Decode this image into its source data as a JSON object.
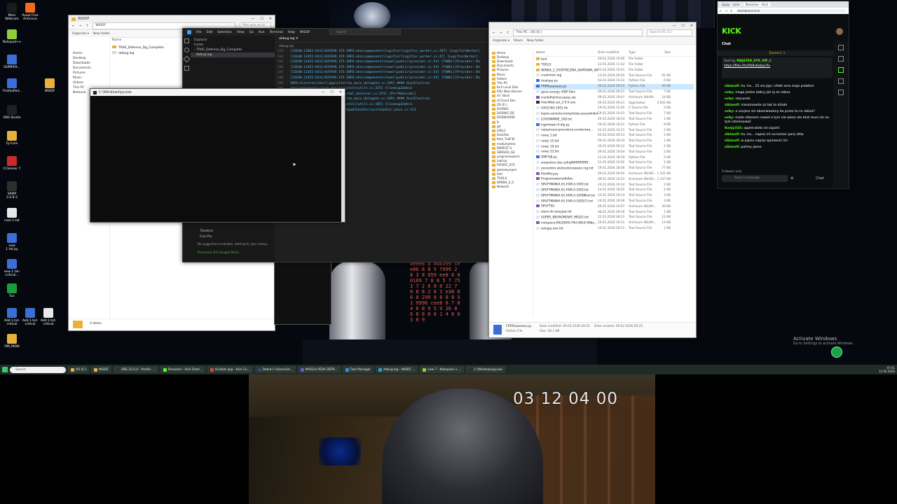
{
  "desktop": {
    "icons": [
      {
        "label": "Mein Webcam",
        "color": "#1b1b1b"
      },
      {
        "label": "Avast Free Antivirus",
        "color": "#f06b1e"
      },
      {
        "label": "Notepad++",
        "color": "#8fcf3c"
      },
      {
        "label": "DUMPER...",
        "color": "#3a6fd8"
      },
      {
        "label": "FirefoxPort...",
        "color": "#3a6fd8"
      },
      {
        "label": "OBS Studio",
        "color": "#202020"
      },
      {
        "label": "Fy-Cam",
        "color": "#e8b23a"
      },
      {
        "label": "CCleaner 7",
        "color": "#cc2b2b"
      },
      {
        "label": "SRMP 3.0.8-2",
        "color": "#2e2e2e"
      },
      {
        "label": "nazr-1.txt",
        "color": "#e8e8e8"
      },
      {
        "label": "new 1.txt.py",
        "color": "#3a6fd8"
      },
      {
        "label": "new 1.txt-critical...",
        "color": "#3a6fd8"
      },
      {
        "label": "Tux",
        "color": "#1a9e3a"
      },
      {
        "label": "Add 1.txt-critical",
        "color": "#3a6fd8"
      },
      {
        "label": "Add 1.txt-critical",
        "color": "#3a6fd8"
      },
      {
        "label": "Add 1.txt-critical",
        "color": "#e8e8e8"
      },
      {
        "label": "OM_MAIN",
        "color": "#e8b23a"
      },
      {
        "label": "WSIDF",
        "color": "#e8b23a"
      }
    ],
    "activate_title": "Activate Windows",
    "activate_sub": "Go to Settings to activate Windows."
  },
  "explorer_left": {
    "address": "WSIDF",
    "search": "Ples wsa.eu.tu",
    "toolbar": [
      "Organize ▾",
      "New folder"
    ],
    "side": [
      "Home",
      "Desktop",
      "Downloads",
      "Documents",
      "Pictures",
      "Music",
      "Videos",
      "This PC",
      "Network"
    ],
    "header": "Name",
    "files": [
      "TRAE_Defense_Dg_Complete",
      "debug.log"
    ],
    "status": "2 items"
  },
  "vscode": {
    "menu": [
      "File",
      "Edit",
      "Selection",
      "View",
      "Go",
      "Run",
      "Terminal",
      "Help",
      "WSIDF"
    ],
    "search": "Search",
    "explorer_title": "Explorer",
    "folder_label": "Folder",
    "tree": [
      "TRAE_Defense_Dg_Complete",
      "debug.log"
    ],
    "tab": "debug.log",
    "breadcrumb": "debug.log",
    "lines": [
      {
        "n": "533",
        "text": "[12648:13052:0311/035939.155:INFO:aho\\components\\logifier\\logifier_worker.cc:297] [LogifierWorker]"
      },
      {
        "n": "534",
        "text": "[12648:12452:0311/035939.155:INFO:aho\\components\\logifier\\logifier_worker.cc:47] [LogifierWorker]"
      },
      {
        "n": "535",
        "text": "[12648:12452:0311/035939.155:INFO:aho\\components\\towel\\public\\provider.cc:54] [TOWEL][Provider::Do"
      },
      {
        "n": "536",
        "text": "[12648:12452:0311/035939.155:INFO:aho\\components\\towel\\public\\provider.cc:54] [TOWEL][Provider::Do"
      },
      {
        "n": "537",
        "text": "[12648:12452:0311/035939.155:INFO:aho\\components\\towel\\public\\provider.cc:54] [TOWEL][Provider::Do"
      },
      {
        "n": "538",
        "text": "[12648:12452:0311/035939.155:INFO:aho\\components\\towel\\public\\provider.cc:54] [TOWEL][Provider::Do"
      },
      {
        "n": "539",
        "text": "INFO:electron\\shell\\app\\electron_main_delegate.cc:299] #### AnalElectron"
      },
      {
        "n": "540",
        "text": "aho\\components\\crash_monitor\\utils\\utils.cc:235] [CleanupZombie"
      },
      {
        "n": "541",
        "text": "aho\\components\\perf\\perf_abnormal_observer.cc:474] [PerfAbnormal]"
      },
      {
        "n": "542",
        "text": "INFO:electron\\shell\\app\\electron_main_delegate.cc:299] #### AnalElectron"
      },
      {
        "n": "543",
        "text": "aho\\components\\crash_monitor\\utils\\utils.cc:265] [CleanupZombie"
      },
      {
        "n": "544",
        "text": "aho\\third_party\\crashpad\\crashpad\\handler\\win\\handler_main.cc:111"
      },
      {
        "n": "545",
        "text": "Inline AI Chat"
      }
    ],
    "timeline": "Timeline",
    "cue_pro": "Cue Pro",
    "suggestion": "No suggestions available, waiting for your coding...",
    "status_line": "Processed 3/3 changed file(s)"
  },
  "console": {
    "title": "C:\\Windows\\py.exe"
  },
  "explorer_right": {
    "address": "This PC  ›  OS (E:)",
    "search": "Search OS (E:)",
    "toolbar": [
      "Organize ▾",
      "Share",
      "New folder"
    ],
    "side": [
      "Home",
      "Desktop",
      "Downloads",
      "Documents",
      "Pictures",
      "Music",
      "Videos",
      "This PC",
      "KLX Local Disk",
      "ESU New Volume",
      "dl ( Back",
      "dl Cloud Dev",
      "OS (E:)",
      "DOSWIC",
      "DOSWIC-DE",
      "DOSWIADSE",
      "B",
      "git",
      "LEKL1",
      "DolaTwe",
      "Kolo_TiaB W",
      "moduleytess",
      "MEREST 0.",
      "SENSOD_GE",
      "programowanie",
      "zapisuj",
      "ROSPIC_SYS",
      "gamewyngen",
      "test",
      "TOOLS",
      "WINDA_2_0",
      "Network"
    ],
    "columns": [
      "Name",
      "Date modified",
      "Type",
      "Size"
    ],
    "rows": [
      {
        "name": "test",
        "date": "09.01.2026 10:00",
        "type": "File folder",
        "size": "",
        "icon": "#e8b23a"
      },
      {
        "name": "TOOLS",
        "date": "23.01.2026 11:42",
        "type": "File folder",
        "size": "",
        "icon": "#e8b23a"
      },
      {
        "name": "WINDA_2_OSTATECZNA_NAPRAWA_WA...",
        "date": "05.02.2026 10:41",
        "type": "File folder",
        "size": "",
        "icon": "#e8b23a"
      },
      {
        "name": "crashmon.log",
        "date": "13.01.2026 09:45",
        "type": "Text Source File",
        "size": "91 KB",
        "icon": "#dfe6ee"
      },
      {
        "name": "dualapp.py",
        "date": "03.01.2026 14:22",
        "type": "Python File",
        "size": "6 KB",
        "icon": "#3a6fd8"
      },
      {
        "name": "FRRRaaaaaaa.py",
        "date": "09.02.2026 09:25",
        "type": "Python File",
        "size": "46 KB",
        "icon": "#3a6fd8"
      },
      {
        "name": "gene.energy AIDP Solv",
        "date": "09.01.2026 09:21",
        "type": "Text Source File",
        "size": "7 KB",
        "icon": "#dfe6ee"
      },
      {
        "name": "insidePatchescapsp.zip",
        "date": "09.01.2026 19:41",
        "type": "Archivum WinRA...",
        "size": "24 KB",
        "icon": "#8a5aa8"
      },
      {
        "name": "InterWeb.set_2.9.0.exe",
        "date": "09.01.2026 09:21",
        "type": "Application",
        "size": "4 001 KB",
        "icon": "#2e2e2e"
      },
      {
        "name": "VXVZ.NO.1001.fix",
        "date": "29.01.2026 15:45",
        "type": "C Source File",
        "size": "5 KB",
        "icon": "#dfe6ee"
      },
      {
        "name": "kopie-sanierte-kompletaly-pasywiiidel...",
        "date": "29.01.2026 10:41",
        "type": "Text Source File",
        "size": "7 KB",
        "icon": "#dfe6ee"
      },
      {
        "name": "LOGOWANIE_100.txt",
        "date": "20.01.2026 18:54",
        "type": "Text Source File",
        "size": "1 KB",
        "icon": "#dfe6ee"
      },
      {
        "name": "loginlower-4.dig.py",
        "date": "29.01.2026 10:21",
        "type": "Python File",
        "size": "9 KB",
        "icon": "#3a6fd8"
      },
      {
        "name": "najnpiesza-procedura-serwisowa...",
        "date": "22.01.2026 14:21",
        "type": "Text Source File",
        "size": "1 KB",
        "icon": "#dfe6ee"
      },
      {
        "name": "nowy 1.txt",
        "date": "04.02.2026 09:13",
        "type": "Text Source File",
        "size": "2 KB",
        "icon": "#dfe6ee"
      },
      {
        "name": "nowy 15.txt",
        "date": "09.01.2026 18:34",
        "type": "Text Source File",
        "size": "1 KB",
        "icon": "#dfe6ee"
      },
      {
        "name": "nowy 19.txt",
        "date": "30.01.2026 09:12",
        "type": "Text Source File",
        "size": "1 KB",
        "icon": "#dfe6ee"
      },
      {
        "name": "nowy 23.txt",
        "date": "09.01.2026 19:04",
        "type": "Text Source File",
        "size": "2 KB",
        "icon": "#dfe6ee"
      },
      {
        "name": "OMFI38.py",
        "date": "12.01.2026 18:29",
        "type": "Python File",
        "size": "5 KB",
        "icon": "#3a6fd8"
      },
      {
        "name": "zmpostne.ster.cyfrgKWRRRRRR..",
        "date": "21.01.2026 10:02",
        "type": "Text Source File",
        "size": "1 KB",
        "icon": "#dfe6ee"
      },
      {
        "name": "posrednio wieloczlonowane reg.txt",
        "date": "19.01.2026 18:48",
        "type": "Text Source File",
        "size": "77 KB",
        "icon": "#dfe6ee"
      },
      {
        "name": "PoroNicy.py",
        "date": "09.01.2026 09:45",
        "type": "Archivum WinRA...",
        "size": "1 341 KB",
        "icon": "#8a5aa8"
      },
      {
        "name": "Programowanie6dtoc",
        "date": "09.01.2026 10:52",
        "type": "Archivum WinRA...",
        "size": "1 237 KB",
        "icon": "#8a5aa8"
      },
      {
        "name": "SPUFTMANIA 61-FAIR.A.GOD.txt",
        "date": "24.01.2026 19:14",
        "type": "Text Source File",
        "size": "2 KB",
        "icon": "#dfe6ee"
      },
      {
        "name": "SPUFTMANIA 61-FAIR.A.GOD.txt",
        "date": "24.01.2026 18:42",
        "type": "Text Source File",
        "size": "1 KB",
        "icon": "#dfe6ee"
      },
      {
        "name": "SPUFTMANIA 61-FAIR.A.GODMod.txt",
        "date": "24.01.2026 19:14",
        "type": "Text Source File",
        "size": "4 KB",
        "icon": "#dfe6ee"
      },
      {
        "name": "SPUFTMANIA 61-FAIR.A.GOD(7).txt",
        "date": "24.01.2026 19:09",
        "type": "Text Source File",
        "size": "4 KB",
        "icon": "#dfe6ee"
      },
      {
        "name": "SPUFTSU",
        "date": "09.01.2026 10:07",
        "type": "Archivum WinRA...",
        "size": "49 KB",
        "icon": "#8a5aa8"
      },
      {
        "name": "stare-do-wszyjaa.txt",
        "date": "08.01.2026 09:20",
        "type": "Text Source File",
        "size": "1 KB",
        "icon": "#dfe6ee"
      },
      {
        "name": "SUPER_NEURONOWY_MOZG.txt",
        "date": "22.01.2026 08:21",
        "type": "Text Source File",
        "size": "12 KB",
        "icon": "#dfe6ee"
      },
      {
        "name": "inolspace-84(2904)-F9d-4824-99be...",
        "date": "29.01.2026 19:11",
        "type": "Archivum WinRA...",
        "size": "14 KB",
        "icon": "#8a5aa8"
      },
      {
        "name": "zaloguj.exe.txt",
        "date": "10.01.2026 09:21",
        "type": "Text Source File",
        "size": "1 KB",
        "icon": "#dfe6ee"
      }
    ],
    "details_name": "FRRRaaaaaaa.py",
    "details_date_label": "Date modified: 09.02.2026 09:25",
    "details_type": "Python File",
    "details_size": "Size: 46.1 KB",
    "details_created": "Date created: 09.02.2026 09:25"
  },
  "kick": {
    "tab1": "kppjy - Lorix",
    "tab2": "Streamer - Kick",
    "address": "dashboard.kick",
    "logo": "KICK",
    "chat_title": "Chat",
    "banner": "Ranners: 1",
    "pinned_user": "MAJSTER_SYS_VIP_C",
    "pinned_prefix": "Sent by",
    "pinned_link": "https://files.lfm/f/b8v8ubjw7tv",
    "messages": [
      {
        "user": "zibiwolf:",
        "text": "ha..ha... 25 sie jaja i efekt zero maja problem"
      },
      {
        "user": "svby:",
        "text": "mega jestes dobry jak ty to robisz"
      },
      {
        "user": "svby:",
        "text": "szacunek"
      },
      {
        "user": "zibiwolf:",
        "text": "niesamowite az tak to działa"
      },
      {
        "user": "svby:",
        "text": "a czujesz sie obserwowany bo przez to co robisz?"
      },
      {
        "user": "svby:",
        "text": "może zdaniem nawet o tym nie wiesz ale ktoś musi sie na tyle interesować"
      },
      {
        "user": "Kanjy333:",
        "text": "oppleratoła sie szpont"
      },
      {
        "user": "zibiwolf:",
        "text": "ha..ha... napisz im na koniec parę słów"
      },
      {
        "user": "zibiwolf:",
        "text": "w pięciu napisz wymienić ich"
      },
      {
        "user": "zibiwolf:",
        "text": "palimy jasne"
      }
    ],
    "followers_only": "Followers only",
    "send_placeholder": "Send a message",
    "send_button": "Chat"
  },
  "taskbar": {
    "search": "Search",
    "items": [
      {
        "label": "OS (E:)",
        "color": "#e8b23a"
      },
      {
        "label": "WSIDF",
        "color": "#e8b23a"
      },
      {
        "label": "OBS 32.0.4 - Profile: ...",
        "color": "#303030"
      },
      {
        "label": "Streamer - Kick Dash...",
        "color": "#53fc18"
      },
      {
        "label": "Kickbot.app - Kick Co...",
        "color": "#d8453a"
      },
      {
        "label": "Debut C:\\Users\\Us...",
        "color": "#2e4a6e"
      },
      {
        "label": "MOGLA PEDA DEPR...",
        "color": "#6a5acd"
      },
      {
        "label": "Task Manager",
        "color": "#3a8ed8"
      },
      {
        "label": "debug.log - WSIDF ...",
        "color": "#23a0d8"
      },
      {
        "label": "new 7 - Notepad++ ...",
        "color": "#8fcf3c"
      },
      {
        "label": "C:\\Windows\\py.exe",
        "color": "#2e2e2e"
      }
    ],
    "time": "07:41",
    "date": "12.02.2026"
  },
  "webcam": {
    "clock": "03 12 04 00"
  }
}
